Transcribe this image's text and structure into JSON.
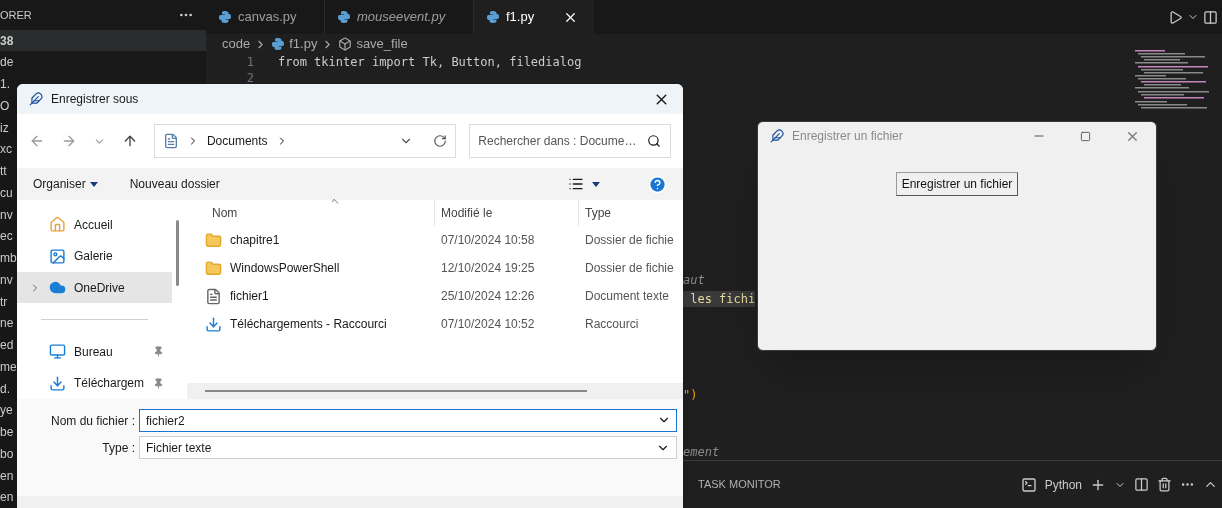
{
  "explorer": {
    "title": "ORER",
    "workspace": "38",
    "items": [
      "de",
      "1.",
      "O",
      "iz",
      "xc",
      "tt",
      "cu",
      "nv",
      "ec",
      "mb",
      "nv",
      "tr",
      "ne",
      "ed",
      "me",
      "d.",
      "ye",
      "be",
      "bo",
      "en",
      "en"
    ]
  },
  "tabs": [
    {
      "label": "canvas.py",
      "selected": false,
      "preview": false
    },
    {
      "label": "mouseevent.py",
      "selected": false,
      "preview": true
    },
    {
      "label": "f1.py",
      "selected": true,
      "preview": false
    }
  ],
  "breadcrumb": [
    "code",
    "f1.py",
    "save_file"
  ],
  "editor": {
    "lines": [
      {
        "number": "1",
        "code": "from tkinter import Tk, Button, filedialog"
      },
      {
        "number": "2"
      },
      {
        "code": "aut",
        "kind": "comment"
      },
      {
        "code": " les fichi",
        "kind": "highlight"
      },
      {
        "code": "\")",
        "kind": "string"
      },
      {
        "code": "ement",
        "kind": "comment"
      }
    ]
  },
  "panel": {
    "title": "TASK MONITOR",
    "terminal": "Python"
  },
  "save_dialog": {
    "title": "Enregistrer sous",
    "address": [
      "Documents"
    ],
    "search": {
      "placeholder": "Rechercher dans : Docume…"
    },
    "toolbar": {
      "organize": "Organiser",
      "new_folder": "Nouveau dossier"
    },
    "nav_top": [
      {
        "label": "Accueil",
        "kind": "home",
        "selected": false,
        "expandable": false
      },
      {
        "label": "Galerie",
        "kind": "gallery",
        "selected": false,
        "expandable": false
      },
      {
        "label": "OneDrive",
        "kind": "cloud",
        "selected": true,
        "expandable": true
      }
    ],
    "nav_pinned": [
      {
        "label": "Bureau",
        "kind": "desktop",
        "pinned": true
      },
      {
        "label": "Téléchargem",
        "kind": "download",
        "pinned": true
      }
    ],
    "columns": [
      "Nom",
      "Modifié le",
      "Type"
    ],
    "files": [
      {
        "name": "chapitre1",
        "modified": "07/10/2024 10:58",
        "type": "Dossier de fichie",
        "kind": "folder"
      },
      {
        "name": "WindowsPowerShell",
        "modified": "12/10/2024 19:25",
        "type": "Dossier de fichie",
        "kind": "folder"
      },
      {
        "name": "fichier1",
        "modified": "25/10/2024 12:26",
        "type": "Document texte",
        "kind": "document"
      },
      {
        "name": "Téléchargements - Raccourci",
        "modified": "07/10/2024 10:52",
        "type": "Raccourci",
        "kind": "shortcut"
      }
    ],
    "filename": {
      "label": "Nom du fichier :",
      "value": "fichier2"
    },
    "filetype": {
      "label": "Type :",
      "value": "Fichier texte"
    }
  },
  "tk_window": {
    "title": "Enregistrer un fichier",
    "active": false,
    "button": "Enregistrer un fichier"
  }
}
